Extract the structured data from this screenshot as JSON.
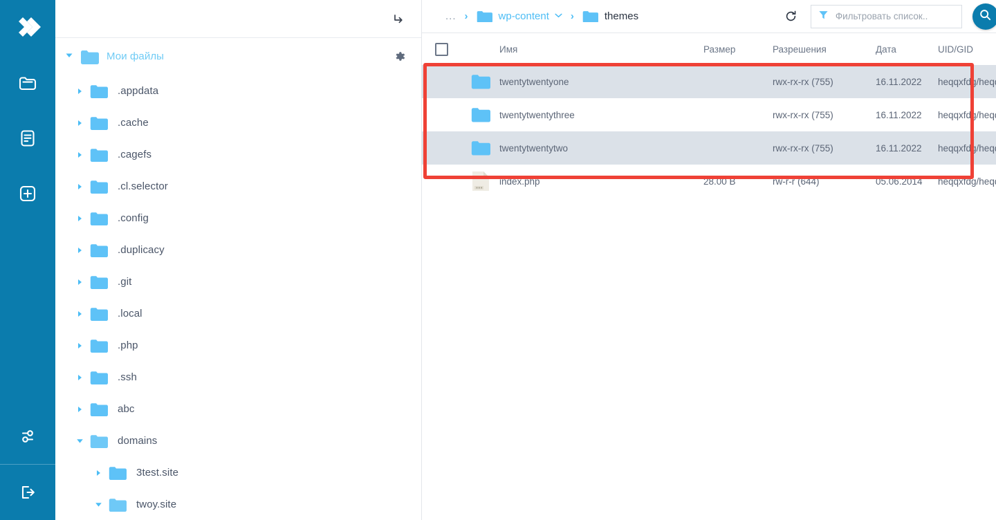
{
  "rail": {
    "items": [
      {
        "name": "logo",
        "icon": "double-chevron-right-logo-icon"
      },
      {
        "name": "file-manager",
        "icon": "folder-icon"
      },
      {
        "name": "logs",
        "icon": "document-lines-icon"
      },
      {
        "name": "add",
        "icon": "plus-square-icon"
      },
      {
        "name": "settings",
        "icon": "sliders-icon"
      },
      {
        "name": "logout",
        "icon": "logout-icon"
      }
    ]
  },
  "tree": {
    "header_icon": "enter-arrow-icon",
    "root": {
      "label": "Мои файлы",
      "expanded": true,
      "settings_icon": "gear-icon"
    },
    "items": [
      {
        "label": ".appdata",
        "depth": 1,
        "expanded": false
      },
      {
        "label": ".cache",
        "depth": 1,
        "expanded": false
      },
      {
        "label": ".cagefs",
        "depth": 1,
        "expanded": false
      },
      {
        "label": ".cl.selector",
        "depth": 1,
        "expanded": false
      },
      {
        "label": ".config",
        "depth": 1,
        "expanded": false
      },
      {
        "label": ".duplicacy",
        "depth": 1,
        "expanded": false
      },
      {
        "label": ".git",
        "depth": 1,
        "expanded": false
      },
      {
        "label": ".local",
        "depth": 1,
        "expanded": false
      },
      {
        "label": ".php",
        "depth": 1,
        "expanded": false
      },
      {
        "label": ".ssh",
        "depth": 1,
        "expanded": false
      },
      {
        "label": "abc",
        "depth": 1,
        "expanded": false
      },
      {
        "label": "domains",
        "depth": 1,
        "expanded": true
      },
      {
        "label": "3test.site",
        "depth": 2,
        "expanded": false
      },
      {
        "label": "twoy.site",
        "depth": 2,
        "expanded": true
      }
    ]
  },
  "breadcrumb": {
    "ellipsis": "...",
    "separator": "›",
    "items": [
      {
        "label": "wp-content",
        "current": false,
        "has_dropdown": true
      },
      {
        "label": "themes",
        "current": true,
        "has_dropdown": false
      }
    ]
  },
  "toolbar": {
    "refresh_icon": "refresh-icon",
    "filter_icon": "funnel-icon",
    "filter_placeholder": "Фильтровать список..",
    "filter_value": "",
    "search_icon": "search-icon"
  },
  "table": {
    "columns": {
      "name": "Имя",
      "size": "Размер",
      "permissions": "Разрешения",
      "date": "Дата",
      "uidgid": "UID/GID"
    },
    "rows": [
      {
        "icon": "folder-icon",
        "name": "twentytwentyone",
        "size": "",
        "permissions": "rwx-rx-rx (755)",
        "date": "16.11.2022",
        "uidgid": "heqqxfdg/heqqxfdg",
        "highlighted": true
      },
      {
        "icon": "folder-icon",
        "name": "twentytwentythree",
        "size": "",
        "permissions": "rwx-rx-rx (755)",
        "date": "16.11.2022",
        "uidgid": "heqqxfdg/heqqxfdg",
        "highlighted": false
      },
      {
        "icon": "folder-icon",
        "name": "twentytwentytwo",
        "size": "",
        "permissions": "rwx-rx-rx (755)",
        "date": "16.11.2022",
        "uidgid": "heqqxfdg/heqqxfdg",
        "highlighted": true
      },
      {
        "icon": "file-icon",
        "name": "index.php",
        "size": "28.00 B",
        "permissions": "rw-r-r (644)",
        "date": "05.06.2014",
        "uidgid": "heqqxfdg/heqqxfdg",
        "highlighted": false
      }
    ]
  },
  "annotation": {
    "shape": "rectangle",
    "color": "#ef4136"
  },
  "colors": {
    "rail_blue": "#0b7cad",
    "accent_blue": "#4dbdf5",
    "folder_blue": "#5ec2f7",
    "row_highlight": "#dbe1e8",
    "annotation_red": "#ef4136",
    "text_dark": "#2b3442",
    "text_muted": "#6b7687"
  }
}
